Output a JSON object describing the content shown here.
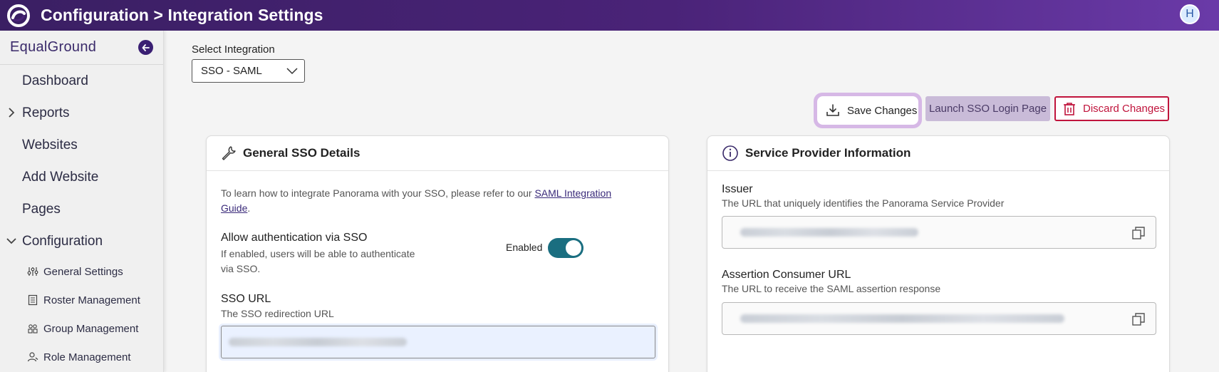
{
  "header": {
    "title": "Configuration > Integration Settings",
    "avatar_initial": "H"
  },
  "sidebar": {
    "org_name": "EqualGround",
    "items": [
      {
        "label": "Dashboard"
      },
      {
        "label": "Reports",
        "expandable": true,
        "expanded": false
      },
      {
        "label": "Websites"
      },
      {
        "label": "Add Website"
      },
      {
        "label": "Pages"
      },
      {
        "label": "Configuration",
        "expandable": true,
        "expanded": true
      }
    ],
    "sub_items": [
      {
        "label": "General Settings",
        "icon": "sliders-icon"
      },
      {
        "label": "Roster Management",
        "icon": "roster-icon"
      },
      {
        "label": "Group Management",
        "icon": "group-icon"
      },
      {
        "label": "Role Management",
        "icon": "role-icon"
      }
    ]
  },
  "integration": {
    "label": "Select Integration",
    "selected": "SSO - SAML"
  },
  "actions": {
    "save": "Save Changes",
    "launch": "Launch SSO Login Page",
    "discard": "Discard Changes"
  },
  "general": {
    "title": "General SSO Details",
    "intro_prefix": "To learn how to integrate Panorama with your SSO, please refer to our ",
    "intro_link_1": "SAML Integration",
    "intro_link_2": "Guide",
    "intro_suffix": ".",
    "allow_title": "Allow authentication via SSO",
    "allow_desc_1": "If enabled, users will be able to authenticate",
    "allow_desc_2": "via SSO.",
    "toggle_label": "Enabled",
    "toggle_on": true,
    "sso_url_title": "SSO URL",
    "sso_url_desc": "The SSO redirection URL"
  },
  "provider": {
    "title": "Service Provider Information",
    "issuer_title": "Issuer",
    "issuer_desc": "The URL that uniquely identifies the Panorama Service Provider",
    "acs_title": "Assertion Consumer URL",
    "acs_desc": "The URL to receive the SAML assertion response"
  },
  "colors": {
    "header_start": "#3a1f63",
    "header_end": "#6a3aa8",
    "toggle_on": "#1a6e80",
    "discard": "#c0143c",
    "save_ring": "#d6b8e6"
  }
}
